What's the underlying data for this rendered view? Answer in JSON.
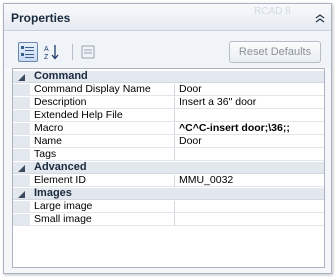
{
  "panel": {
    "title": "Properties",
    "ghost_text": "RCAD 8",
    "toolbar": {
      "categorized_icon": "categorized-icon",
      "alphabetical_icon": "sort-alphabetical-icon",
      "property_pages_icon": "property-pages-icon",
      "reset_label": "Reset Defaults"
    }
  },
  "grid": {
    "categories": [
      {
        "label": "Command",
        "rows": [
          {
            "name": "Command Display Name",
            "value": "Door"
          },
          {
            "name": "Description",
            "value": "Insert a 36\" door"
          },
          {
            "name": "Extended Help File",
            "value": ""
          },
          {
            "name": "Macro",
            "value": "^C^C-insert door;\\36;;"
          },
          {
            "name": "Name",
            "value": "Door"
          },
          {
            "name": "Tags",
            "value": ""
          }
        ]
      },
      {
        "label": "Advanced",
        "rows": [
          {
            "name": "Element ID",
            "value": "MMU_0032"
          }
        ]
      },
      {
        "label": "Images",
        "rows": [
          {
            "name": "Large image",
            "value": ""
          },
          {
            "name": "Small image",
            "value": ""
          }
        ]
      }
    ]
  },
  "colors": {
    "accent": "#3f6fb6",
    "category_bg": "#e3e8ef",
    "border": "#a9b3c2"
  }
}
